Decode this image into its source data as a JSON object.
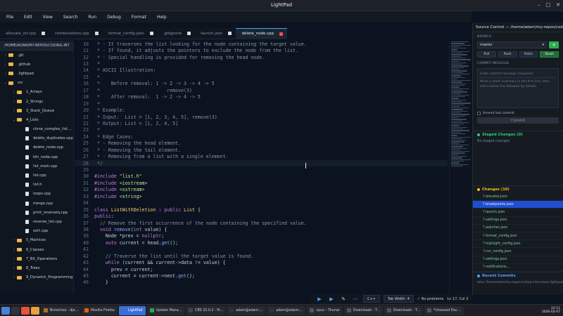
{
  "window": {
    "title": "LightPad",
    "controls": [
      "–",
      "□",
      "✕"
    ]
  },
  "menu": [
    "File",
    "Edit",
    "View",
    "Search",
    "Run",
    "Debug",
    "Format",
    "Help"
  ],
  "tabs": [
    {
      "label": "allocate_str.cpp",
      "active": false
    },
    {
      "label": "combinations.cpp",
      "active": false
    },
    {
      "label": "format_config.json",
      "active": false
    },
    {
      "label": ".gitignore",
      "active": false
    },
    {
      "label": "launch.json",
      "active": false
    },
    {
      "label": "delete_node.cpp",
      "active": true
    }
  ],
  "sidebar": {
    "header": "/HOME/ADAM/MY-REPOS/CODING-INT",
    "items": [
      {
        "label": ".git",
        "type": "folder",
        "depth": 0,
        "chev": "›"
      },
      {
        "label": ".github",
        "type": "folder",
        "depth": 0,
        "chev": "›"
      },
      {
        "label": ".lightpad",
        "type": "folder",
        "depth": 0,
        "chev": "›"
      },
      {
        "label": "src",
        "type": "folder",
        "depth": 0,
        "chev": "⌄"
      },
      {
        "label": "1_Arrays",
        "type": "folder",
        "depth": 1,
        "chev": "›"
      },
      {
        "label": "2_Strings",
        "type": "folder",
        "depth": 1,
        "chev": "›"
      },
      {
        "label": "3_Stack_Queue",
        "type": "folder",
        "depth": 1,
        "chev": "›"
      },
      {
        "label": "4_Lists",
        "type": "folder",
        "depth": 1,
        "chev": "⌄"
      },
      {
        "label": "clone_complex_list....",
        "type": "file",
        "depth": 2,
        "chev": ""
      },
      {
        "label": "delete_duplicates.cpp",
        "type": "file",
        "depth": 2,
        "chev": ""
      },
      {
        "label": "delete_node.cpp",
        "type": "file",
        "depth": 2,
        "chev": ""
      },
      {
        "label": "kth_node.cpp",
        "type": "file",
        "depth": 2,
        "chev": ""
      },
      {
        "label": "list_main.cpp",
        "type": "file",
        "depth": 2,
        "chev": ""
      },
      {
        "label": "list.cpp",
        "type": "file",
        "depth": 2,
        "chev": ""
      },
      {
        "label": "list.h",
        "type": "file",
        "depth": 2,
        "chev": ""
      },
      {
        "label": "loops.cpp",
        "type": "file",
        "depth": 2,
        "chev": ""
      },
      {
        "label": "merge.cpp",
        "type": "file",
        "depth": 2,
        "chev": ""
      },
      {
        "label": "print_reversely.cpp",
        "type": "file",
        "depth": 2,
        "chev": ""
      },
      {
        "label": "reverse_list.cpp",
        "type": "file",
        "depth": 2,
        "chev": ""
      },
      {
        "label": "sort.cpp",
        "type": "file",
        "depth": 2,
        "chev": ""
      },
      {
        "label": "5_Matrices",
        "type": "folder",
        "depth": 1,
        "chev": "›"
      },
      {
        "label": "6_Classes",
        "type": "folder",
        "depth": 1,
        "chev": "›"
      },
      {
        "label": "7_Bit_Operations",
        "type": "folder",
        "depth": 1,
        "chev": "›"
      },
      {
        "label": "8_Trees",
        "type": "folder",
        "depth": 1,
        "chev": "›"
      },
      {
        "label": "9_Dynamic_Programming",
        "type": "folder",
        "depth": 1,
        "chev": "›"
      }
    ]
  },
  "editor": {
    "current_line": 28,
    "lines": [
      {
        "n": "10",
        "html": "<span class='cm'> * - It traverses the list looking for the node containing the target value.</span>"
      },
      {
        "n": "11",
        "html": "<span class='cm'> * - If found, it adjusts the pointers to exclude the node from the list.</span>"
      },
      {
        "n": "12",
        "html": "<span class='cm'> * - Special handling is provided for removing the head node.</span>"
      },
      {
        "n": "13",
        "html": "<span class='cm'> *</span>"
      },
      {
        "n": "14",
        "html": "<span class='cm'> * ASCII Illustration:</span>"
      },
      {
        "n": "15",
        "html": "<span class='cm'> *</span>"
      },
      {
        "n": "16",
        "html": "<span class='cm'> *    Before removal: 1 -> 2 -> 3 -> 4 -> 5</span>"
      },
      {
        "n": "17",
        "html": "<span class='cm'> *                        remove(3)</span>"
      },
      {
        "n": "18",
        "html": "<span class='cm'> *    After removal:  1 -> 2 -> 4 -> 5</span>"
      },
      {
        "n": "19",
        "html": "<span class='cm'> *</span>"
      },
      {
        "n": "20",
        "html": "<span class='cm'> * Example:</span>"
      },
      {
        "n": "21",
        "html": "<span class='cm'> * Input:  List = [1, 2, 3, 4, 5], remove(3)</span>"
      },
      {
        "n": "22",
        "html": "<span class='cm'> * Output: List = [1, 2, 4, 5]</span>"
      },
      {
        "n": "23",
        "html": "<span class='cm'> *</span>"
      },
      {
        "n": "24",
        "html": "<span class='cm'> * Edge Cases:</span>"
      },
      {
        "n": "25",
        "html": "<span class='cm'> * - Removing the head element.</span>"
      },
      {
        "n": "26",
        "html": "<span class='cm'> * - Removing the tail element.</span>"
      },
      {
        "n": "27",
        "html": "<span class='cm'> * - Removing from a list with a single element.</span>"
      },
      {
        "n": "28",
        "html": "<span class='cm'> */</span>"
      },
      {
        "n": "29",
        "html": ""
      },
      {
        "n": "30",
        "html": "<span class='kw'>#include</span> <span class='st'>\"list.h\"</span>"
      },
      {
        "n": "31",
        "html": "<span class='kw'>#include</span> <span class='st'>&lt;iostream&gt;</span>"
      },
      {
        "n": "32",
        "html": "<span class='kw'>#include</span> <span class='st'>&lt;sstream&gt;</span>"
      },
      {
        "n": "33",
        "html": "<span class='kw'>#include</span> <span class='st'>&lt;string&gt;</span>"
      },
      {
        "n": "34",
        "html": ""
      },
      {
        "n": "35",
        "html": "<span class='kw'>class</span> <span class='ty'>ListWithDeletion</span> : <span class='kw'>public</span> <span class='ty'>List</span> {"
      },
      {
        "n": "36",
        "html": "<span class='kw'>public</span>:"
      },
      {
        "n": "37",
        "html": "  <span class='cm'>// Remove the first occurrence of the node containing the specified value.</span>"
      },
      {
        "n": "38",
        "html": "  <span class='kw'>void</span> <span class='fn'>remove</span>(<span class='kw'>int</span> value) {"
      },
      {
        "n": "39",
        "html": "    Node *prev = <span class='kw'>nullptr</span>;"
      },
      {
        "n": "40",
        "html": "    <span class='kw'>auto</span> current = head.<span class='fn'>get</span>();"
      },
      {
        "n": "41",
        "html": ""
      },
      {
        "n": "42",
        "html": "    <span class='cm'>// Traverse the list until the target value is found.</span>"
      },
      {
        "n": "43",
        "html": "    <span class='kw'>while</span> (current &amp;&amp; current->data != value) {"
      },
      {
        "n": "44",
        "html": "      prev = current;"
      },
      {
        "n": "45",
        "html": "      current = current->next.<span class='fn'>get</span>();"
      },
      {
        "n": "46",
        "html": "    }"
      }
    ]
  },
  "source_control": {
    "title": "Source Control — /home/adam/my-repos/codin",
    "branch_label": "BRANCH",
    "branch_value": "master",
    "buttons": [
      "Pull",
      "Push",
      "Fetch",
      "Stash"
    ],
    "commit_label": "COMMIT MESSAGE",
    "commit_placeholder": "Enter commit message (required)",
    "commit_body_placeholder": "Write a short summary in the first line, then add a blank line followed by details.",
    "amend_label": "Amend last commit",
    "commit_button": "Commit",
    "staged_header": "Staged Changes (0)",
    "staged_empty": "No staged changes",
    "changes_header": "Changes (10)",
    "changes": [
      "?.elevator.json",
      "?.breakpoints.json",
      "?.launch.json",
      "?.settings.json",
      "?.watches.json",
      "?.format_config.json",
      "?.highlight_config.json",
      "?.run_config.json",
      "?.settings.json",
      "?.notifications..."
    ],
    "selected_change": 1,
    "recent_header": "Recent Commits",
    "recent_path": "fatal: /home/adam/my-repos/coding-interviews/.lightpad/data"
  },
  "status": {
    "language": "C++",
    "tab_width": "Tab Width: 4",
    "problems": "✓ No problems",
    "position": "Ln 17, Col 3"
  },
  "taskbar": {
    "tasks": [
      {
        "label": "Brzoichex - dje...",
        "color": "#b36b2c",
        "active": false
      },
      {
        "label": "Mozilla Firefox",
        "color": "#e66000",
        "active": false
      },
      {
        "label": "LightPad",
        "color": "#3a6fd8",
        "active": true
      },
      {
        "label": "Update Mana...",
        "color": "#2ea44f",
        "active": false
      },
      {
        "label": "CBS 32.0.2 - Pr...",
        "color": "#444",
        "active": false
      },
      {
        "label": "adam@adam:...",
        "color": "#333",
        "active": false
      },
      {
        "label": "adam@adam:...",
        "color": "#333",
        "active": false
      },
      {
        "label": "cpuv - Thunar",
        "color": "#555",
        "active": false
      },
      {
        "label": "Downloads - T...",
        "color": "#555",
        "active": false
      },
      {
        "label": "Downloads - T...",
        "color": "#555",
        "active": false
      },
      {
        "label": "*Unsaved Doc...",
        "color": "#555",
        "active": false
      }
    ],
    "time": "22:11",
    "date": "2026-02-07"
  }
}
